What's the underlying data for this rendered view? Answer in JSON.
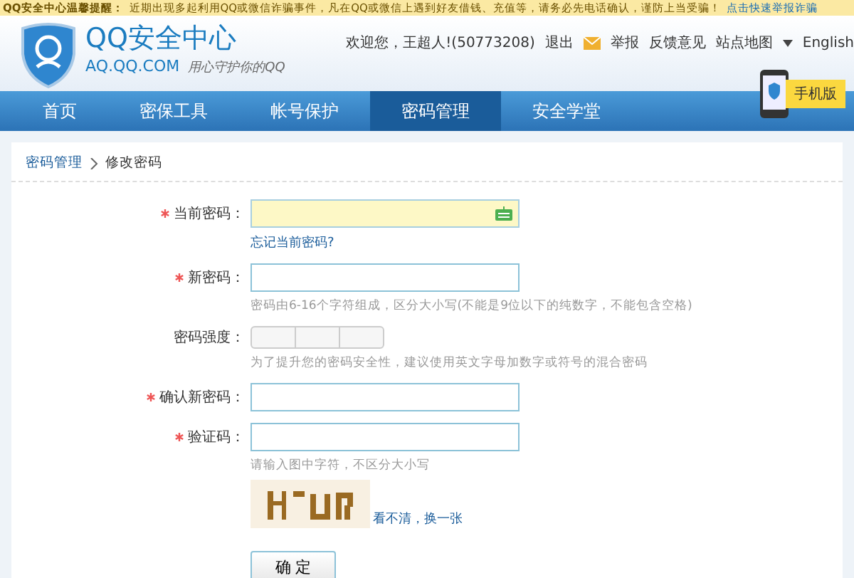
{
  "notice": {
    "title": "QQ安全中心温馨提醒：",
    "text": "近期出现多起利用QQ或微信诈骗事件，凡在QQ或微信上遇到好友借钱、充值等，请务必先电话确认，谨防上当受骗！",
    "link": "点击快速举报诈骗"
  },
  "header": {
    "logo_title": "QQ安全中心",
    "logo_domain": "AQ.QQ.COM",
    "slogan": "用心守护你的QQ",
    "welcome": "欢迎您，王超人!(50773208)",
    "logout": "退出",
    "links": [
      "举报",
      "反馈意见"
    ],
    "sitemap": "站点地图",
    "language": "English",
    "mobile_badge": "手机版"
  },
  "nav": [
    {
      "label": "首页",
      "selected": false
    },
    {
      "label": "密保工具",
      "selected": false
    },
    {
      "label": "帐号保护",
      "selected": false
    },
    {
      "label": "密码管理",
      "selected": true
    },
    {
      "label": "安全学堂",
      "selected": false
    }
  ],
  "breadcrumb": [
    "密码管理",
    "修改密码"
  ],
  "form": {
    "fields": [
      {
        "kind": "input",
        "label": "当前密码：",
        "required": true,
        "focused": true,
        "keyboard": true,
        "link": "忘记当前密码?"
      },
      {
        "kind": "input",
        "label": "新密码：",
        "required": true,
        "focused": false,
        "hint": "密码由6-16个字符组成，区分大小写(不能是9位以下的纯数字，不能包含空格)"
      },
      {
        "kind": "strength",
        "label": "密码强度：",
        "required": false,
        "hint": "为了提升您的密码安全性，建议使用英文字母加数字或符号的混合密码"
      },
      {
        "kind": "input",
        "label": "确认新密码：",
        "required": true,
        "focused": false
      },
      {
        "kind": "captcha",
        "label": "验证码：",
        "required": true,
        "focused": false,
        "hint": "请输入图中字符，不区分大小写",
        "refresh": "看不清，换一张"
      }
    ],
    "submit": "确 定"
  }
}
